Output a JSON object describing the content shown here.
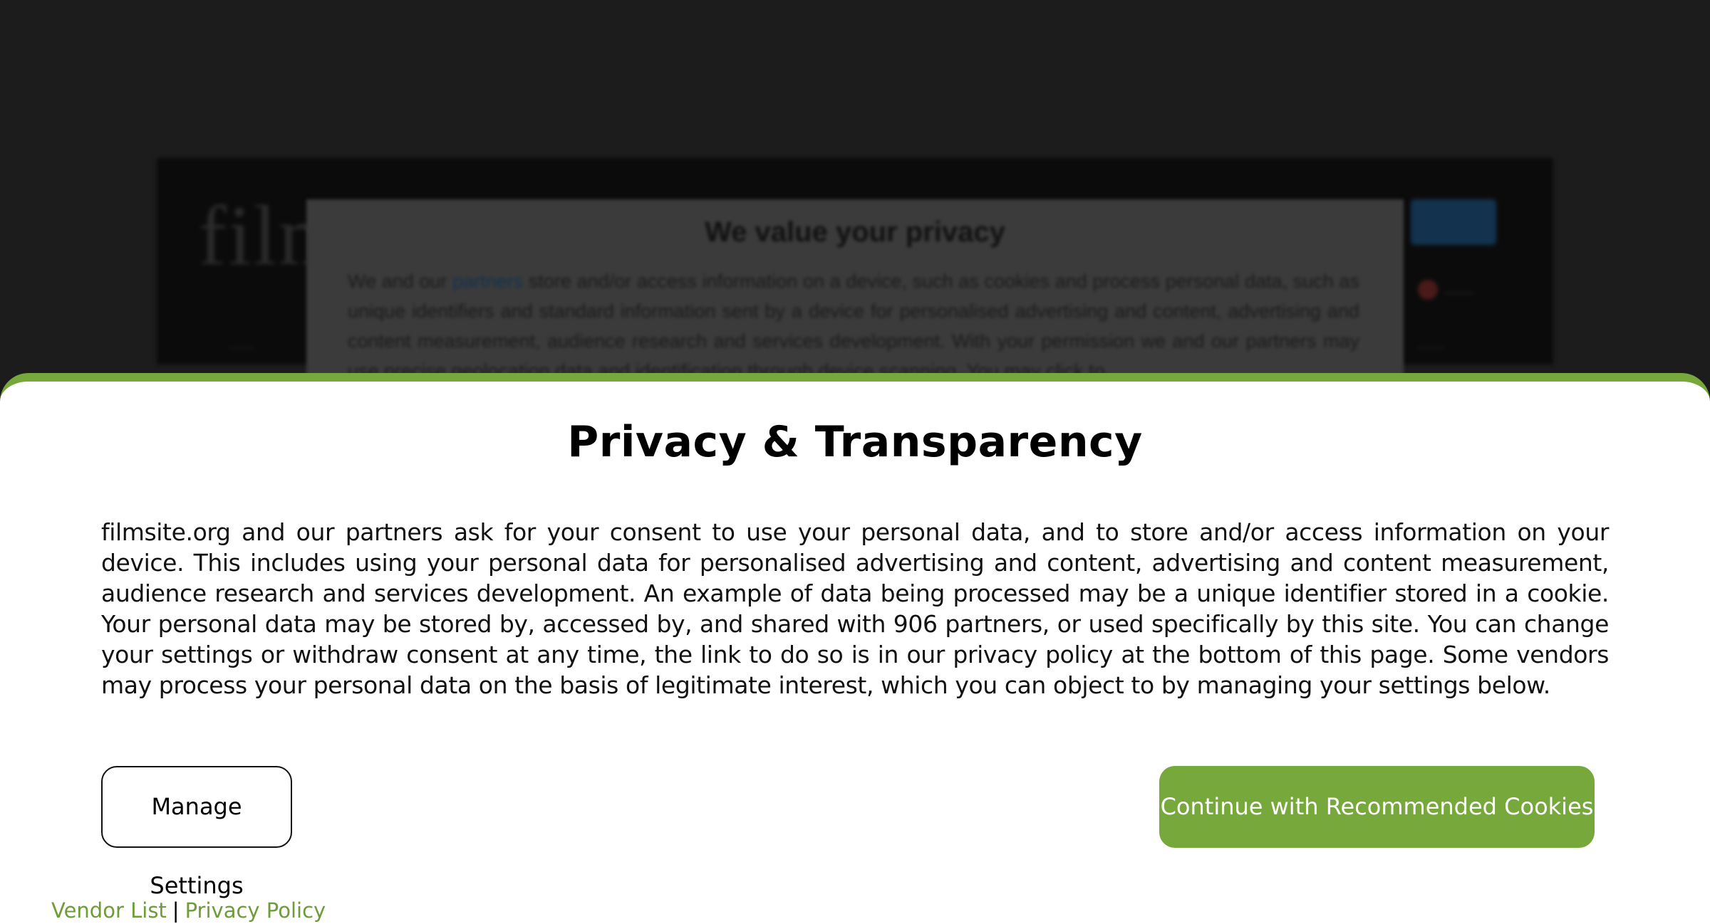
{
  "background": {
    "logo_text": "film",
    "nav_left": "......",
    "nav_right": "......",
    "login_text": "......",
    "dialog": {
      "title": "We value your privacy",
      "text_before_link": "We and our ",
      "link": "partners",
      "text_after_link": " store and/or access information on a device, such as cookies and process personal data, such as unique identifiers and standard information sent by a device for personalised advertising and content, advertising and content measurement, audience research and services development. With your permission we and our partners may use precise geolocation data and identification through device scanning. You may click to"
    }
  },
  "consent": {
    "title": "Privacy & Transparency",
    "body": "filmsite.org and our partners ask for your consent to use your personal data, and to store and/or access information on your device. This includes using your personal data for personalised advertising and content, advertising and content measurement, audience research and services development. An example of data being processed may be a unique identifier stored in a cookie. Your personal data may be stored by, accessed by, and shared with 906 partners, or used specifically by this site. You can change your settings or withdraw consent at any time, the link to do so is in our privacy policy at the bottom of this page. Some vendors may process your personal data on the basis of legitimate interest, which you can object to by managing your settings below.",
    "manage_button": "Manage Settings",
    "accept_button": "Continue with Recommended Cookies",
    "footer": {
      "vendor_list": "Vendor List",
      "separator": "|",
      "privacy_policy": "Privacy Policy"
    }
  },
  "colors": {
    "accent": "#76a83c",
    "link": "#6e9c38",
    "overlay": "#1c1c1c"
  }
}
